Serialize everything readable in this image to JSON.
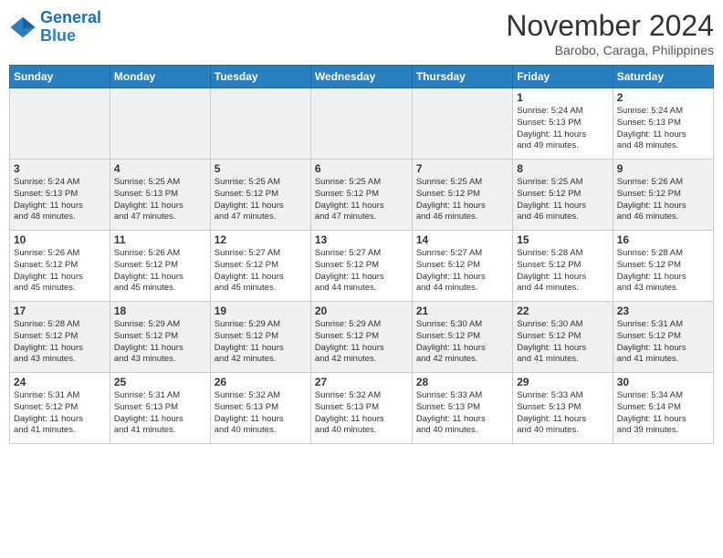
{
  "logo": {
    "line1": "General",
    "line2": "Blue"
  },
  "title": "November 2024",
  "location": "Barobo, Caraga, Philippines",
  "days_of_week": [
    "Sunday",
    "Monday",
    "Tuesday",
    "Wednesday",
    "Thursday",
    "Friday",
    "Saturday"
  ],
  "weeks": [
    [
      {
        "day": "",
        "info": ""
      },
      {
        "day": "",
        "info": ""
      },
      {
        "day": "",
        "info": ""
      },
      {
        "day": "",
        "info": ""
      },
      {
        "day": "",
        "info": ""
      },
      {
        "day": "1",
        "info": "Sunrise: 5:24 AM\nSunset: 5:13 PM\nDaylight: 11 hours\nand 49 minutes."
      },
      {
        "day": "2",
        "info": "Sunrise: 5:24 AM\nSunset: 5:13 PM\nDaylight: 11 hours\nand 48 minutes."
      }
    ],
    [
      {
        "day": "3",
        "info": "Sunrise: 5:24 AM\nSunset: 5:13 PM\nDaylight: 11 hours\nand 48 minutes."
      },
      {
        "day": "4",
        "info": "Sunrise: 5:25 AM\nSunset: 5:13 PM\nDaylight: 11 hours\nand 47 minutes."
      },
      {
        "day": "5",
        "info": "Sunrise: 5:25 AM\nSunset: 5:12 PM\nDaylight: 11 hours\nand 47 minutes."
      },
      {
        "day": "6",
        "info": "Sunrise: 5:25 AM\nSunset: 5:12 PM\nDaylight: 11 hours\nand 47 minutes."
      },
      {
        "day": "7",
        "info": "Sunrise: 5:25 AM\nSunset: 5:12 PM\nDaylight: 11 hours\nand 46 minutes."
      },
      {
        "day": "8",
        "info": "Sunrise: 5:25 AM\nSunset: 5:12 PM\nDaylight: 11 hours\nand 46 minutes."
      },
      {
        "day": "9",
        "info": "Sunrise: 5:26 AM\nSunset: 5:12 PM\nDaylight: 11 hours\nand 46 minutes."
      }
    ],
    [
      {
        "day": "10",
        "info": "Sunrise: 5:26 AM\nSunset: 5:12 PM\nDaylight: 11 hours\nand 45 minutes."
      },
      {
        "day": "11",
        "info": "Sunrise: 5:26 AM\nSunset: 5:12 PM\nDaylight: 11 hours\nand 45 minutes."
      },
      {
        "day": "12",
        "info": "Sunrise: 5:27 AM\nSunset: 5:12 PM\nDaylight: 11 hours\nand 45 minutes."
      },
      {
        "day": "13",
        "info": "Sunrise: 5:27 AM\nSunset: 5:12 PM\nDaylight: 11 hours\nand 44 minutes."
      },
      {
        "day": "14",
        "info": "Sunrise: 5:27 AM\nSunset: 5:12 PM\nDaylight: 11 hours\nand 44 minutes."
      },
      {
        "day": "15",
        "info": "Sunrise: 5:28 AM\nSunset: 5:12 PM\nDaylight: 11 hours\nand 44 minutes."
      },
      {
        "day": "16",
        "info": "Sunrise: 5:28 AM\nSunset: 5:12 PM\nDaylight: 11 hours\nand 43 minutes."
      }
    ],
    [
      {
        "day": "17",
        "info": "Sunrise: 5:28 AM\nSunset: 5:12 PM\nDaylight: 11 hours\nand 43 minutes."
      },
      {
        "day": "18",
        "info": "Sunrise: 5:29 AM\nSunset: 5:12 PM\nDaylight: 11 hours\nand 43 minutes."
      },
      {
        "day": "19",
        "info": "Sunrise: 5:29 AM\nSunset: 5:12 PM\nDaylight: 11 hours\nand 42 minutes."
      },
      {
        "day": "20",
        "info": "Sunrise: 5:29 AM\nSunset: 5:12 PM\nDaylight: 11 hours\nand 42 minutes."
      },
      {
        "day": "21",
        "info": "Sunrise: 5:30 AM\nSunset: 5:12 PM\nDaylight: 11 hours\nand 42 minutes."
      },
      {
        "day": "22",
        "info": "Sunrise: 5:30 AM\nSunset: 5:12 PM\nDaylight: 11 hours\nand 41 minutes."
      },
      {
        "day": "23",
        "info": "Sunrise: 5:31 AM\nSunset: 5:12 PM\nDaylight: 11 hours\nand 41 minutes."
      }
    ],
    [
      {
        "day": "24",
        "info": "Sunrise: 5:31 AM\nSunset: 5:12 PM\nDaylight: 11 hours\nand 41 minutes."
      },
      {
        "day": "25",
        "info": "Sunrise: 5:31 AM\nSunset: 5:13 PM\nDaylight: 11 hours\nand 41 minutes."
      },
      {
        "day": "26",
        "info": "Sunrise: 5:32 AM\nSunset: 5:13 PM\nDaylight: 11 hours\nand 40 minutes."
      },
      {
        "day": "27",
        "info": "Sunrise: 5:32 AM\nSunset: 5:13 PM\nDaylight: 11 hours\nand 40 minutes."
      },
      {
        "day": "28",
        "info": "Sunrise: 5:33 AM\nSunset: 5:13 PM\nDaylight: 11 hours\nand 40 minutes."
      },
      {
        "day": "29",
        "info": "Sunrise: 5:33 AM\nSunset: 5:13 PM\nDaylight: 11 hours\nand 40 minutes."
      },
      {
        "day": "30",
        "info": "Sunrise: 5:34 AM\nSunset: 5:14 PM\nDaylight: 11 hours\nand 39 minutes."
      }
    ]
  ]
}
